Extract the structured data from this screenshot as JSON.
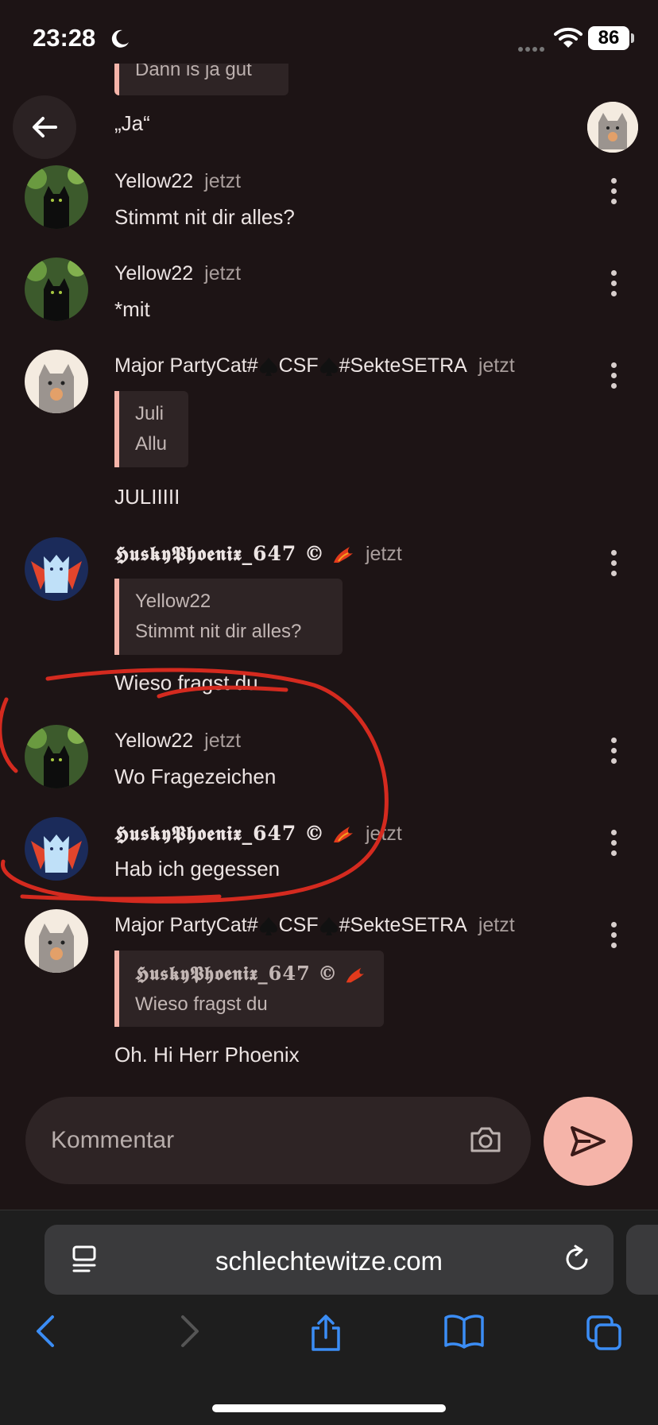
{
  "status_bar": {
    "time": "23:28",
    "battery": "86"
  },
  "header": {
    "partial_quote": "Dann is ja gut",
    "previous_text": "„Ja“"
  },
  "messages": [
    {
      "author": "Yellow22",
      "time": "jetzt",
      "text": "Stimmt nit dir alles?"
    },
    {
      "author": "Yellow22",
      "time": "jetzt",
      "text": "*mit"
    },
    {
      "author_pre": "Major PartyCat#",
      "author_mid": "CSF",
      "author_post": "#SekteSETRA",
      "time": "jetzt",
      "quote_author": "Juli",
      "quote_text": "Allu",
      "text": "JULIIIII"
    },
    {
      "author": "𝕳𝖚𝖘𝖐𝖞𝕻𝖍𝖔𝖊𝖓𝖎𝖝_647 ©",
      "time": "jetzt",
      "quote_author": "Yellow22",
      "quote_text": "Stimmt nit dir alles?",
      "text": "Wieso fragst du"
    },
    {
      "author": "Yellow22",
      "time": "jetzt",
      "text": "Wo Fragezeichen"
    },
    {
      "author": "𝕳𝖚𝖘𝖐𝖞𝕻𝖍𝖔𝖊𝖓𝖎𝖝_647 ©",
      "time": "jetzt",
      "text": "Hab ich gegessen"
    },
    {
      "author_pre": "Major PartyCat#",
      "author_mid": "CSF",
      "author_post": "#SekteSETRA",
      "time": "jetzt",
      "quote_author": "𝕳𝖚𝖘𝖐𝖞𝕻𝖍𝖔𝖊𝖓𝖎𝖝_647 ©",
      "quote_text": "Wieso fragst du",
      "text": "Oh. Hi Herr Phoenix"
    }
  ],
  "composer": {
    "placeholder": "Kommentar"
  },
  "browser": {
    "url": "schlechtewitze.com"
  },
  "colors": {
    "background": "#1d1415",
    "accent": "#f5b4a9",
    "bubble": "#2e2425",
    "annotation": "#d42a1f"
  }
}
